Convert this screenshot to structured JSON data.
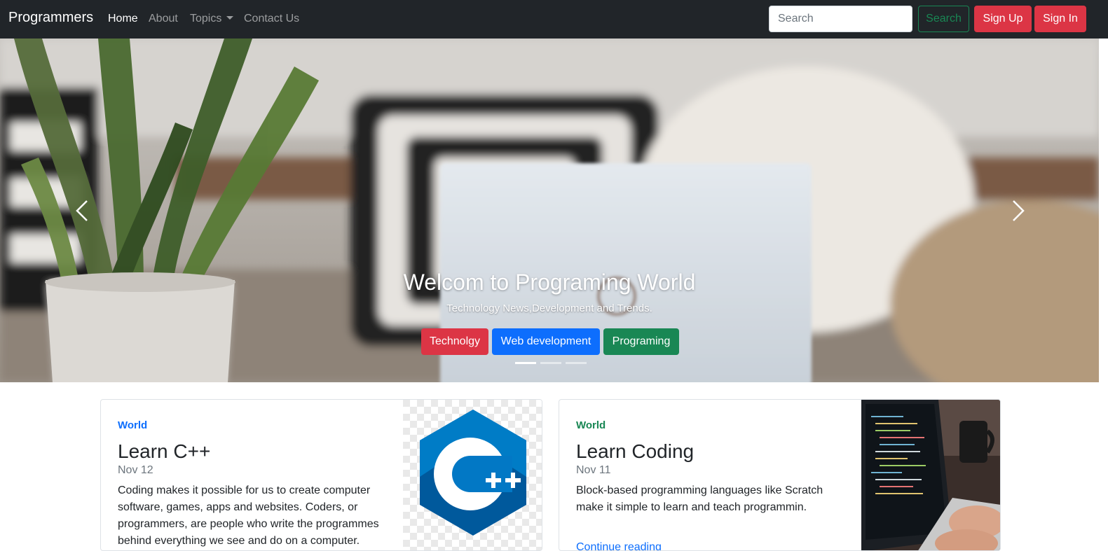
{
  "navbar": {
    "brand": "Programmers",
    "links": [
      {
        "label": "Home",
        "active": true
      },
      {
        "label": "About"
      },
      {
        "label": "Topics",
        "dropdown": true
      },
      {
        "label": "Contact Us"
      }
    ],
    "search_placeholder": "Search",
    "search_button": "Search",
    "signup_button": "Sign Up",
    "signin_button": "Sign In"
  },
  "hero": {
    "title": "Welcom to Programing World",
    "subtitle": "Technology News,Development and Trends.",
    "buttons": [
      "Technolgy",
      "Web development",
      "Programing"
    ],
    "active_slide": 1,
    "slide_count": 3
  },
  "cards": [
    {
      "category": "World",
      "category_color": "#0d6efd",
      "title": "Learn C++",
      "date": "Nov 12",
      "text": "Coding makes it possible for us to create computer software, games, apps and websites. Coders, or programmers, are people who write the programmes behind everything we see and do on a computer.",
      "image": "cpp-logo"
    },
    {
      "category": "World",
      "category_color": "#198754",
      "title": "Learn Coding",
      "date": "Nov 11",
      "text": "Block-based programming languages like Scratch make it simple to learn and teach programmin.",
      "link": "Continue reading",
      "image": "laptop-coding-photo"
    }
  ],
  "colors": {
    "navbar_bg": "#212529",
    "danger": "#dc3545",
    "primary": "#0d6efd",
    "success": "#198754"
  }
}
